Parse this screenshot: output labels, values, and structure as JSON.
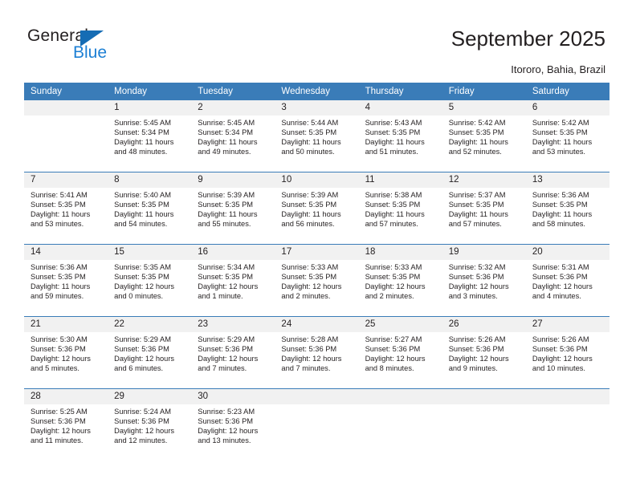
{
  "brand": {
    "name_top": "General",
    "name_bottom": "Blue",
    "accent_color": "#1c7fd4",
    "triangle_color": "#156cb4"
  },
  "header": {
    "title": "September 2025",
    "location": "Itororo, Bahia, Brazil"
  },
  "calendar": {
    "header_bg": "#3a7cb8",
    "daynum_bg": "#f1f1f1",
    "weekday_headers": [
      "Sunday",
      "Monday",
      "Tuesday",
      "Wednesday",
      "Thursday",
      "Friday",
      "Saturday"
    ],
    "weeks": [
      [
        {
          "day": "",
          "sunrise": "",
          "sunset": "",
          "daylight_line1": "",
          "daylight_line2": ""
        },
        {
          "day": "1",
          "sunrise": "Sunrise: 5:45 AM",
          "sunset": "Sunset: 5:34 PM",
          "daylight_line1": "Daylight: 11 hours",
          "daylight_line2": "and 48 minutes."
        },
        {
          "day": "2",
          "sunrise": "Sunrise: 5:45 AM",
          "sunset": "Sunset: 5:34 PM",
          "daylight_line1": "Daylight: 11 hours",
          "daylight_line2": "and 49 minutes."
        },
        {
          "day": "3",
          "sunrise": "Sunrise: 5:44 AM",
          "sunset": "Sunset: 5:35 PM",
          "daylight_line1": "Daylight: 11 hours",
          "daylight_line2": "and 50 minutes."
        },
        {
          "day": "4",
          "sunrise": "Sunrise: 5:43 AM",
          "sunset": "Sunset: 5:35 PM",
          "daylight_line1": "Daylight: 11 hours",
          "daylight_line2": "and 51 minutes."
        },
        {
          "day": "5",
          "sunrise": "Sunrise: 5:42 AM",
          "sunset": "Sunset: 5:35 PM",
          "daylight_line1": "Daylight: 11 hours",
          "daylight_line2": "and 52 minutes."
        },
        {
          "day": "6",
          "sunrise": "Sunrise: 5:42 AM",
          "sunset": "Sunset: 5:35 PM",
          "daylight_line1": "Daylight: 11 hours",
          "daylight_line2": "and 53 minutes."
        }
      ],
      [
        {
          "day": "7",
          "sunrise": "Sunrise: 5:41 AM",
          "sunset": "Sunset: 5:35 PM",
          "daylight_line1": "Daylight: 11 hours",
          "daylight_line2": "and 53 minutes."
        },
        {
          "day": "8",
          "sunrise": "Sunrise: 5:40 AM",
          "sunset": "Sunset: 5:35 PM",
          "daylight_line1": "Daylight: 11 hours",
          "daylight_line2": "and 54 minutes."
        },
        {
          "day": "9",
          "sunrise": "Sunrise: 5:39 AM",
          "sunset": "Sunset: 5:35 PM",
          "daylight_line1": "Daylight: 11 hours",
          "daylight_line2": "and 55 minutes."
        },
        {
          "day": "10",
          "sunrise": "Sunrise: 5:39 AM",
          "sunset": "Sunset: 5:35 PM",
          "daylight_line1": "Daylight: 11 hours",
          "daylight_line2": "and 56 minutes."
        },
        {
          "day": "11",
          "sunrise": "Sunrise: 5:38 AM",
          "sunset": "Sunset: 5:35 PM",
          "daylight_line1": "Daylight: 11 hours",
          "daylight_line2": "and 57 minutes."
        },
        {
          "day": "12",
          "sunrise": "Sunrise: 5:37 AM",
          "sunset": "Sunset: 5:35 PM",
          "daylight_line1": "Daylight: 11 hours",
          "daylight_line2": "and 57 minutes."
        },
        {
          "day": "13",
          "sunrise": "Sunrise: 5:36 AM",
          "sunset": "Sunset: 5:35 PM",
          "daylight_line1": "Daylight: 11 hours",
          "daylight_line2": "and 58 minutes."
        }
      ],
      [
        {
          "day": "14",
          "sunrise": "Sunrise: 5:36 AM",
          "sunset": "Sunset: 5:35 PM",
          "daylight_line1": "Daylight: 11 hours",
          "daylight_line2": "and 59 minutes."
        },
        {
          "day": "15",
          "sunrise": "Sunrise: 5:35 AM",
          "sunset": "Sunset: 5:35 PM",
          "daylight_line1": "Daylight: 12 hours",
          "daylight_line2": "and 0 minutes."
        },
        {
          "day": "16",
          "sunrise": "Sunrise: 5:34 AM",
          "sunset": "Sunset: 5:35 PM",
          "daylight_line1": "Daylight: 12 hours",
          "daylight_line2": "and 1 minute."
        },
        {
          "day": "17",
          "sunrise": "Sunrise: 5:33 AM",
          "sunset": "Sunset: 5:35 PM",
          "daylight_line1": "Daylight: 12 hours",
          "daylight_line2": "and 2 minutes."
        },
        {
          "day": "18",
          "sunrise": "Sunrise: 5:33 AM",
          "sunset": "Sunset: 5:35 PM",
          "daylight_line1": "Daylight: 12 hours",
          "daylight_line2": "and 2 minutes."
        },
        {
          "day": "19",
          "sunrise": "Sunrise: 5:32 AM",
          "sunset": "Sunset: 5:36 PM",
          "daylight_line1": "Daylight: 12 hours",
          "daylight_line2": "and 3 minutes."
        },
        {
          "day": "20",
          "sunrise": "Sunrise: 5:31 AM",
          "sunset": "Sunset: 5:36 PM",
          "daylight_line1": "Daylight: 12 hours",
          "daylight_line2": "and 4 minutes."
        }
      ],
      [
        {
          "day": "21",
          "sunrise": "Sunrise: 5:30 AM",
          "sunset": "Sunset: 5:36 PM",
          "daylight_line1": "Daylight: 12 hours",
          "daylight_line2": "and 5 minutes."
        },
        {
          "day": "22",
          "sunrise": "Sunrise: 5:29 AM",
          "sunset": "Sunset: 5:36 PM",
          "daylight_line1": "Daylight: 12 hours",
          "daylight_line2": "and 6 minutes."
        },
        {
          "day": "23",
          "sunrise": "Sunrise: 5:29 AM",
          "sunset": "Sunset: 5:36 PM",
          "daylight_line1": "Daylight: 12 hours",
          "daylight_line2": "and 7 minutes."
        },
        {
          "day": "24",
          "sunrise": "Sunrise: 5:28 AM",
          "sunset": "Sunset: 5:36 PM",
          "daylight_line1": "Daylight: 12 hours",
          "daylight_line2": "and 7 minutes."
        },
        {
          "day": "25",
          "sunrise": "Sunrise: 5:27 AM",
          "sunset": "Sunset: 5:36 PM",
          "daylight_line1": "Daylight: 12 hours",
          "daylight_line2": "and 8 minutes."
        },
        {
          "day": "26",
          "sunrise": "Sunrise: 5:26 AM",
          "sunset": "Sunset: 5:36 PM",
          "daylight_line1": "Daylight: 12 hours",
          "daylight_line2": "and 9 minutes."
        },
        {
          "day": "27",
          "sunrise": "Sunrise: 5:26 AM",
          "sunset": "Sunset: 5:36 PM",
          "daylight_line1": "Daylight: 12 hours",
          "daylight_line2": "and 10 minutes."
        }
      ],
      [
        {
          "day": "28",
          "sunrise": "Sunrise: 5:25 AM",
          "sunset": "Sunset: 5:36 PM",
          "daylight_line1": "Daylight: 12 hours",
          "daylight_line2": "and 11 minutes."
        },
        {
          "day": "29",
          "sunrise": "Sunrise: 5:24 AM",
          "sunset": "Sunset: 5:36 PM",
          "daylight_line1": "Daylight: 12 hours",
          "daylight_line2": "and 12 minutes."
        },
        {
          "day": "30",
          "sunrise": "Sunrise: 5:23 AM",
          "sunset": "Sunset: 5:36 PM",
          "daylight_line1": "Daylight: 12 hours",
          "daylight_line2": "and 13 minutes."
        },
        {
          "day": "",
          "sunrise": "",
          "sunset": "",
          "daylight_line1": "",
          "daylight_line2": ""
        },
        {
          "day": "",
          "sunrise": "",
          "sunset": "",
          "daylight_line1": "",
          "daylight_line2": ""
        },
        {
          "day": "",
          "sunrise": "",
          "sunset": "",
          "daylight_line1": "",
          "daylight_line2": ""
        },
        {
          "day": "",
          "sunrise": "",
          "sunset": "",
          "daylight_line1": "",
          "daylight_line2": ""
        }
      ]
    ]
  }
}
